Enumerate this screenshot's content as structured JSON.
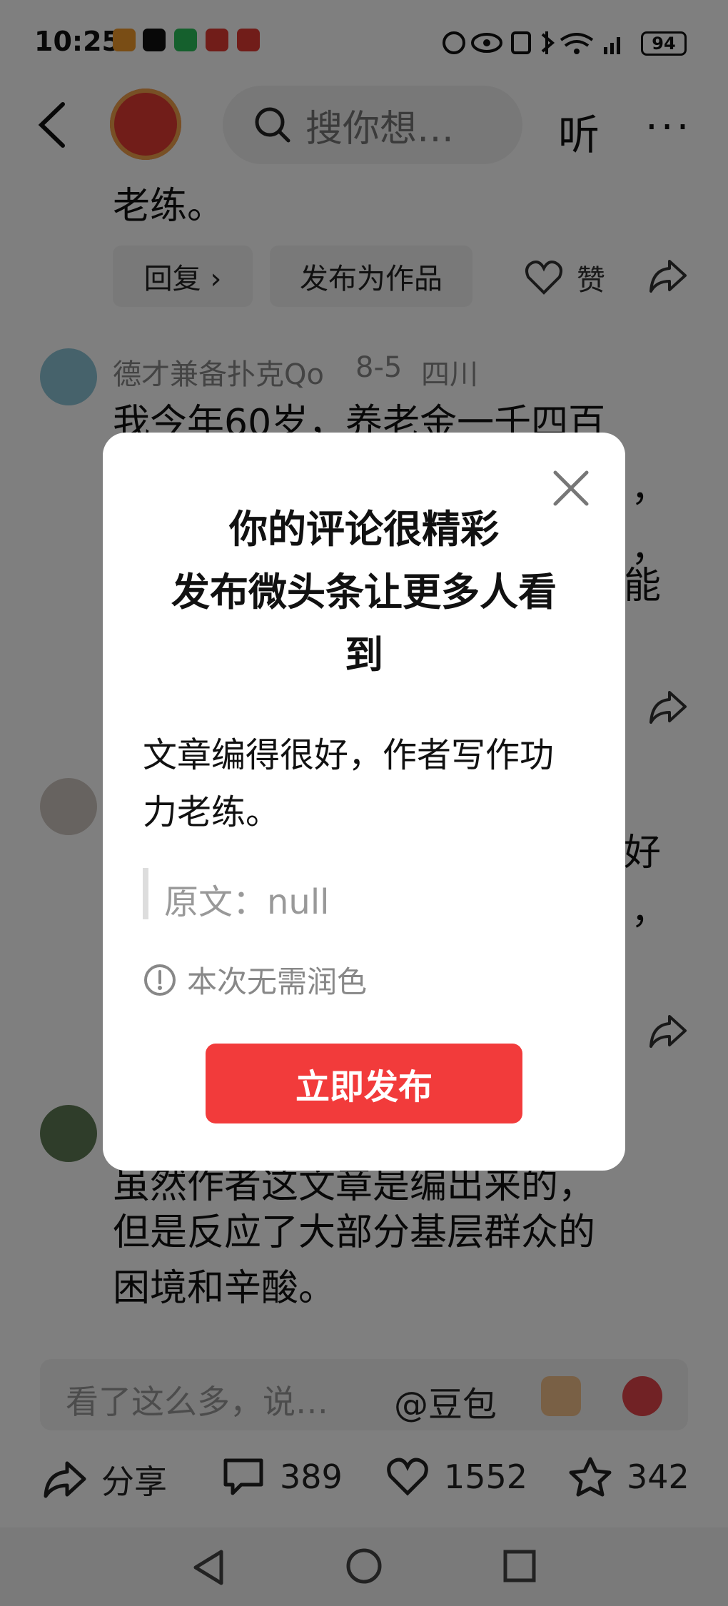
{
  "status_bar": {
    "time": "10:25",
    "battery": "94"
  },
  "header": {
    "search_placeholder": "搜你想…",
    "listen_label": "听",
    "more_label": "···"
  },
  "comments": [
    {
      "text_tail": "老练。",
      "reply_label": "回复 ›",
      "publish_as_work_label": "发布为作品",
      "like_label": "赞"
    },
    {
      "author": "德才兼备扑克Qo",
      "date": "8-5",
      "location": "四川",
      "text_line1": "我今年60岁，养老金一千四百",
      "partial_chars": [
        "，",
        "，",
        "能"
      ]
    },
    {
      "partial_chars": [
        "好",
        "，"
      ]
    },
    {
      "text_lines": [
        "虽然作者这文章是编出来的，",
        "但是反应了大部分基层群众的",
        "困境和辛酸。"
      ]
    }
  ],
  "dialog": {
    "title_lines": [
      "你的评论很精彩",
      "发布微头条让更多人看",
      "到"
    ],
    "body_lines": [
      "文章编得很好，作者写作功",
      "力老练。"
    ],
    "quote_label": "原文：null",
    "info_text": "本次无需润色",
    "publish_label": "立即发布"
  },
  "comment_bar": {
    "placeholder": "看了这么多，说…",
    "doubao_label": "@豆包"
  },
  "bottom_actions": {
    "share_label": "分享",
    "comment_count": "389",
    "like_count": "1552",
    "favorite_count": "342"
  }
}
